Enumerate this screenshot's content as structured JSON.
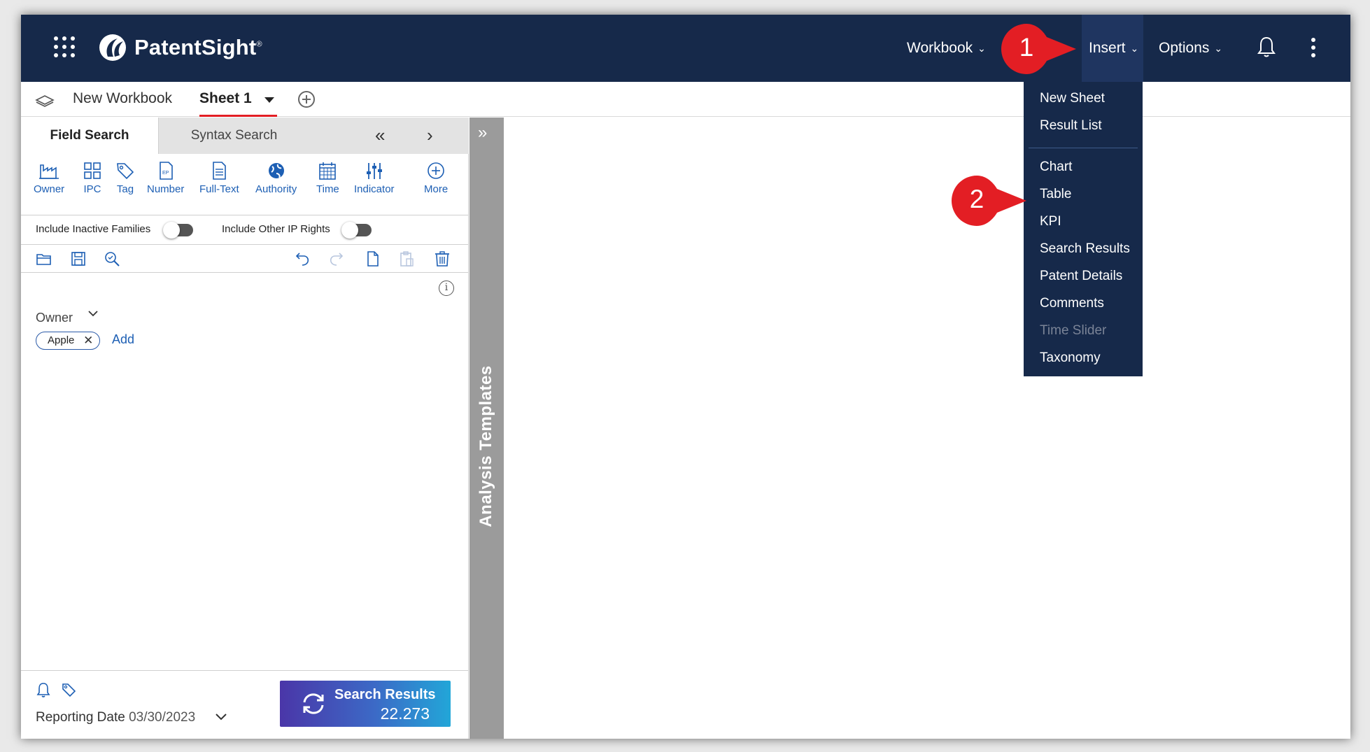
{
  "app": {
    "logo_text": "PatentSight",
    "logo_mark": "®"
  },
  "topnav": {
    "workbook": "Workbook",
    "insert": "Insert",
    "options": "Options",
    "chevron": "⌄"
  },
  "sheetbar": {
    "workbook_name": "New Workbook",
    "active_sheet": "Sheet 1"
  },
  "search_tabs": {
    "field_search": "Field Search",
    "syntax_search": "Syntax Search",
    "collapse": "«",
    "next": "›"
  },
  "field_icons": [
    {
      "label": "Owner",
      "icon": "factory-icon"
    },
    {
      "label": "IPC",
      "icon": "grid-icon"
    },
    {
      "label": "Tag",
      "icon": "tag-icon"
    },
    {
      "label": "Number",
      "icon": "document-ep-icon"
    },
    {
      "label": "Full-Text",
      "icon": "document-lines-icon"
    },
    {
      "label": "Authority",
      "icon": "globe-icon"
    },
    {
      "label": "Time",
      "icon": "calendar-icon"
    },
    {
      "label": "Indicator",
      "icon": "sliders-icon"
    },
    {
      "label": "More",
      "icon": "plus-circle-icon"
    }
  ],
  "toggles": {
    "inactive_families": "Include Inactive Families",
    "other_ip_rights": "Include Other IP Rights"
  },
  "criteria": {
    "info": "i",
    "owner_label": "Owner",
    "chip_value": "Apple",
    "chip_remove": "✕",
    "add_link": "Add"
  },
  "footer": {
    "reporting_label": "Reporting Date",
    "reporting_date": "03/30/2023",
    "search_button_title": "Search Results",
    "search_button_count": "22.273"
  },
  "templates": {
    "label": "Analysis Templates",
    "expand": "»"
  },
  "insert_menu": {
    "items": [
      "New Sheet",
      "Result List",
      "Chart",
      "Table",
      "KPI",
      "Search Results",
      "Patent Details",
      "Comments",
      "Time Slider",
      "Taxonomy"
    ],
    "disabled": [
      "Time Slider"
    ]
  },
  "callouts": {
    "step1": "1",
    "step2": "2",
    "color": "#e31e24"
  },
  "colors": {
    "topbar": "#16294a",
    "accent_blue": "#1d5fb4",
    "active_tab_underline": "#e31e24"
  }
}
